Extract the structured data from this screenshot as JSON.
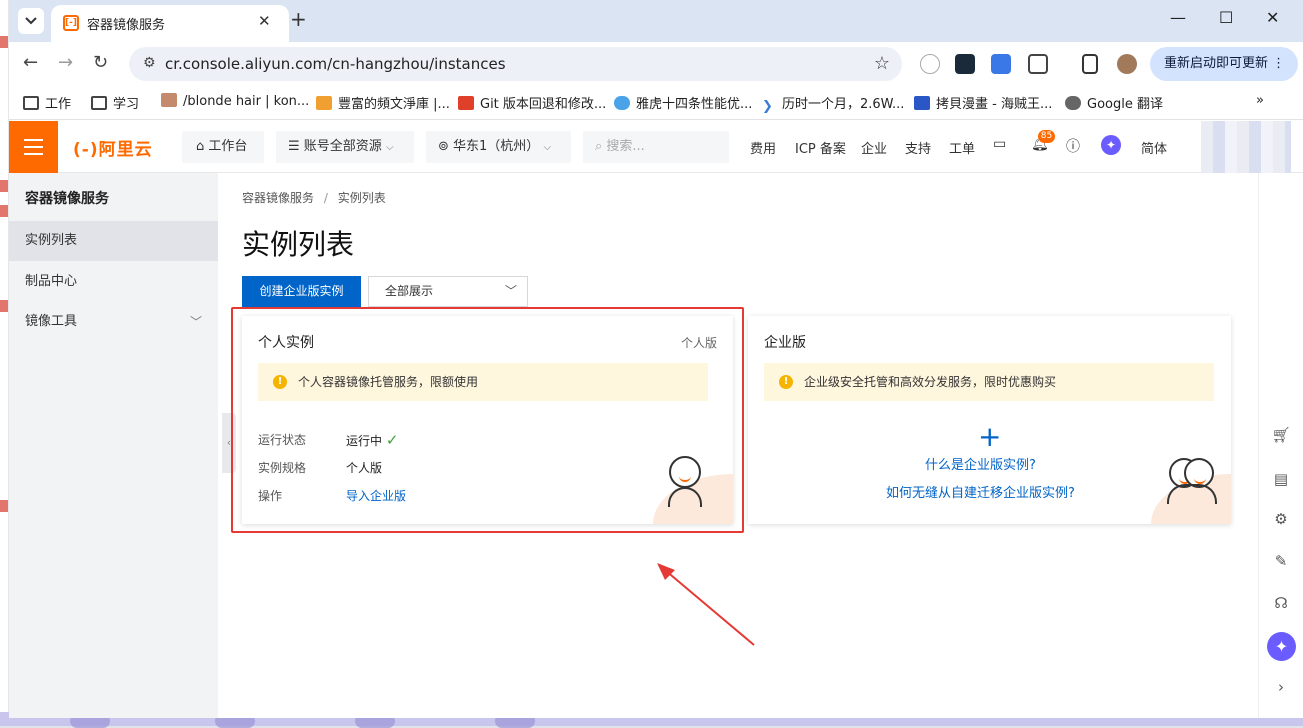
{
  "browser": {
    "tab_title": "容器镜像服务",
    "tab_favicon": "[-]",
    "url": "cr.console.aliyun.com/cn-hangzhou/instances",
    "restart_label": "重新启动即可更新",
    "bookmarks": [
      {
        "label": "工作",
        "icon": "folder-icon"
      },
      {
        "label": "学习",
        "icon": "folder-icon"
      },
      {
        "label": "/blonde hair | kon...",
        "icon": "page-icon"
      },
      {
        "label": "豐富的頻文淨庫 |...",
        "icon": "page-icon"
      },
      {
        "label": "Git 版本回退和修改...",
        "icon": "page-icon"
      },
      {
        "label": "雅虎十四条性能优...",
        "icon": "cloud-icon"
      },
      {
        "label": "历时一个月，2.6W...",
        "icon": "chevron-icon"
      },
      {
        "label": "拷貝漫畫 - 海贼王...",
        "icon": "page-icon"
      },
      {
        "label": "Google 翻译",
        "icon": "globe-icon"
      }
    ]
  },
  "console_header": {
    "logo": "(-)阿里云",
    "workbench": "工作台",
    "resources": "账号全部资源",
    "region": "华东1（杭州）",
    "search_placeholder": "搜索...",
    "links": [
      "费用",
      "ICP 备案",
      "企业",
      "支持",
      "工单"
    ],
    "notification_count": "85",
    "lang": "简体"
  },
  "sidebar": {
    "title": "容器镜像服务",
    "items": [
      {
        "label": "实例列表",
        "active": true
      },
      {
        "label": "制品中心"
      },
      {
        "label": "镜像工具"
      }
    ]
  },
  "main": {
    "breadcrumb": [
      "容器镜像服务",
      "实例列表"
    ],
    "title": "实例列表",
    "create_button": "创建企业版实例",
    "filter_value": "全部展示",
    "personal": {
      "title": "个人实例",
      "tag": "个人版",
      "notice": "个人容器镜像托管服务，限额使用",
      "status_label": "运行状态",
      "status_value": "运行中",
      "spec_label": "实例规格",
      "spec_value": "个人版",
      "action_label": "操作",
      "action_link": "导入企业版"
    },
    "enterprise": {
      "title": "企业版",
      "notice": "企业级安全托管和高效分发服务，限时优惠购买",
      "link1": "什么是企业版实例?",
      "link2": "如何无缝从自建迁移企业版实例?"
    }
  },
  "colors": {
    "brand": "#ff6a00",
    "primary": "#0064c8",
    "highlight": "#e53935"
  }
}
